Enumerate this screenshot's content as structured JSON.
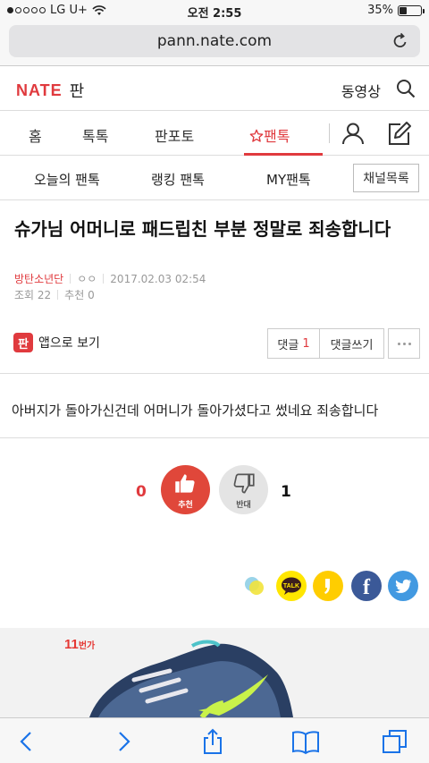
{
  "status": {
    "carrier": "LG U+",
    "time": "오전 2:55",
    "battery": "35%",
    "battery_level": 0.35
  },
  "browser": {
    "url": "pann.nate.com"
  },
  "header": {
    "brand": "NATE",
    "section": "판",
    "video_link": "동영상"
  },
  "main_nav": {
    "tabs": [
      "홈",
      "톡톡",
      "판포토",
      "팬톡"
    ],
    "active_tab": "팬톡"
  },
  "sub_nav": {
    "tabs": [
      "오늘의 팬톡",
      "랭킹 팬톡",
      "MY팬톡"
    ],
    "channel_button": "채널목록"
  },
  "article": {
    "title": "슈가님 어머니로 패드립친 부분 정말로 죄송합니다",
    "author": "방탄소년단",
    "nickname": "ㅇㅇ",
    "date": "2017.02.03 02:54",
    "views": "조회 22",
    "recommends": "추천 0",
    "body": "아버지가 돌아가신건데 어머니가 돌아가셨다고 썼네요 죄송합니다"
  },
  "actions": {
    "app_view": "앱으로 보기",
    "app_icon_text": "판",
    "comments_label": "댓글",
    "comments_count": "1",
    "write_comment": "댓글쓰기"
  },
  "votes": {
    "up_count": "0",
    "up_label": "추천",
    "down_count": "1",
    "down_label": "반대"
  },
  "share": [
    "line-icon",
    "kakaotalk-icon",
    "kakaostory-icon",
    "facebook-icon",
    "twitter-icon"
  ],
  "ad": {
    "brand_main": "11",
    "brand_sub": "번가"
  },
  "colors": {
    "accent": "#e03a3e",
    "kakao": "#ffe600",
    "facebook": "#3b5998",
    "twitter": "#4299e1"
  }
}
